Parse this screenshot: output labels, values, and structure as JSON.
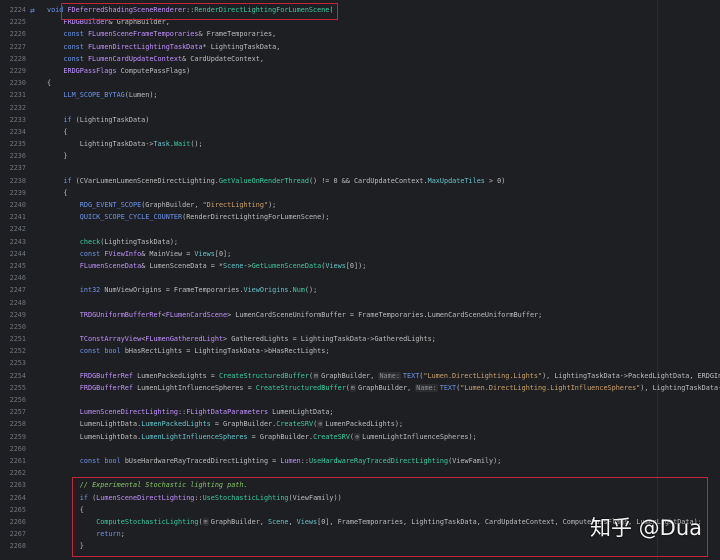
{
  "editor": {
    "watermark": "知乎 @Dua",
    "gutter_icon": "override-arrows-icon",
    "colors": {
      "highlight_box": "#c0283a",
      "background": "#1e1f22"
    },
    "lines": [
      {
        "n": "2224",
        "i": 0,
        "tok": [
          [
            "k",
            "void "
          ],
          [
            "t",
            "FDeferredShadingSceneRenderer"
          ],
          [
            "p",
            "::"
          ],
          [
            "m",
            "RenderDirectLightingForLumenScene"
          ],
          [
            "p",
            "("
          ]
        ]
      },
      {
        "n": "2225",
        "i": 1,
        "tok": [
          [
            "t",
            "FRDGBuilder"
          ],
          [
            "p",
            "& GraphBuilder,"
          ]
        ]
      },
      {
        "n": "2226",
        "i": 1,
        "tok": [
          [
            "k",
            "const "
          ],
          [
            "t",
            "FLumenSceneFrameTemporaries"
          ],
          [
            "p",
            "& FrameTemporaries,"
          ]
        ]
      },
      {
        "n": "2227",
        "i": 1,
        "tok": [
          [
            "k",
            "const "
          ],
          [
            "t",
            "FLumenDirectLightingTaskData"
          ],
          [
            "p",
            "* LightingTaskData,"
          ]
        ]
      },
      {
        "n": "2228",
        "i": 1,
        "tok": [
          [
            "k",
            "const "
          ],
          [
            "t",
            "FLumenCardUpdateContext"
          ],
          [
            "p",
            "& CardUpdateContext,"
          ]
        ]
      },
      {
        "n": "2229",
        "i": 1,
        "tok": [
          [
            "t",
            "ERDGPassFlags"
          ],
          [
            "p",
            " ComputePassFlags)"
          ]
        ]
      },
      {
        "n": "2230",
        "i": 0,
        "tok": [
          [
            "p",
            "{"
          ]
        ]
      },
      {
        "n": "2231",
        "i": 1,
        "tok": [
          [
            "mac",
            "LLM_SCOPE_BYTAG"
          ],
          [
            "p",
            "(Lumen);"
          ]
        ]
      },
      {
        "n": "2232",
        "i": 0,
        "tok": []
      },
      {
        "n": "2233",
        "i": 1,
        "tok": [
          [
            "k",
            "if "
          ],
          [
            "p",
            "(LightingTaskData)"
          ]
        ]
      },
      {
        "n": "2234",
        "i": 1,
        "tok": [
          [
            "p",
            "{"
          ]
        ]
      },
      {
        "n": "2235",
        "i": 2,
        "tok": [
          [
            "p",
            "LightingTaskData->"
          ],
          [
            "f",
            "Task"
          ],
          [
            "p",
            "."
          ],
          [
            "m",
            "Wait"
          ],
          [
            "p",
            "();"
          ]
        ]
      },
      {
        "n": "2236",
        "i": 1,
        "tok": [
          [
            "p",
            "}"
          ]
        ]
      },
      {
        "n": "2237",
        "i": 0,
        "tok": []
      },
      {
        "n": "2238",
        "i": 1,
        "tok": [
          [
            "k",
            "if "
          ],
          [
            "p",
            "(CVarLumenLumenSceneDirectLighting."
          ],
          [
            "m",
            "GetValueOnRenderThread"
          ],
          [
            "p",
            "() != 0 && CardUpdateContext."
          ],
          [
            "f",
            "MaxUpdateTiles"
          ],
          [
            "p",
            " > 0)"
          ]
        ]
      },
      {
        "n": "2239",
        "i": 1,
        "tok": [
          [
            "p",
            "{"
          ]
        ]
      },
      {
        "n": "2240",
        "i": 2,
        "tok": [
          [
            "mac",
            "RDG_EVENT_SCOPE"
          ],
          [
            "p",
            "(GraphBuilder, "
          ],
          [
            "s",
            "\"DirectLighting\""
          ],
          [
            "p",
            ");"
          ]
        ]
      },
      {
        "n": "2241",
        "i": 2,
        "tok": [
          [
            "mac",
            "QUICK_SCOPE_CYCLE_COUNTER"
          ],
          [
            "p",
            "(RenderDirectLightingForLumenScene);"
          ]
        ]
      },
      {
        "n": "2242",
        "i": 0,
        "tok": []
      },
      {
        "n": "2243",
        "i": 2,
        "tok": [
          [
            "m",
            "check"
          ],
          [
            "p",
            "(LightingTaskData);"
          ]
        ]
      },
      {
        "n": "2244",
        "i": 2,
        "tok": [
          [
            "k",
            "const "
          ],
          [
            "t",
            "FViewInfo"
          ],
          [
            "p",
            "& MainView = "
          ],
          [
            "f",
            "Views"
          ],
          [
            "p",
            "[0];"
          ]
        ]
      },
      {
        "n": "2245",
        "i": 2,
        "tok": [
          [
            "t",
            "FLumenSceneData"
          ],
          [
            "p",
            "& LumenSceneData = *"
          ],
          [
            "f",
            "Scene"
          ],
          [
            "p",
            "->"
          ],
          [
            "m",
            "GetLumenSceneData"
          ],
          [
            "p",
            "("
          ],
          [
            "f",
            "Views"
          ],
          [
            "p",
            "[0]);"
          ]
        ]
      },
      {
        "n": "2246",
        "i": 0,
        "tok": []
      },
      {
        "n": "2247",
        "i": 2,
        "tok": [
          [
            "k",
            "int32 "
          ],
          [
            "p",
            "NumViewOrigins = FrameTemporaries."
          ],
          [
            "f",
            "ViewOrigins"
          ],
          [
            "p",
            "."
          ],
          [
            "m",
            "Num"
          ],
          [
            "p",
            "();"
          ]
        ]
      },
      {
        "n": "2248",
        "i": 0,
        "tok": []
      },
      {
        "n": "2249",
        "i": 2,
        "tok": [
          [
            "t",
            "TRDGUniformBufferRef"
          ],
          [
            "p",
            "<"
          ],
          [
            "t",
            "FLumenCardScene"
          ],
          [
            "p",
            "> LumenCardSceneUniformBuffer = FrameTemporaries.LumenCardSceneUniformBuffer;"
          ]
        ]
      },
      {
        "n": "2250",
        "i": 0,
        "tok": []
      },
      {
        "n": "2251",
        "i": 2,
        "tok": [
          [
            "t",
            "TConstArrayView"
          ],
          [
            "p",
            "<"
          ],
          [
            "t",
            "FLumenGatheredLight"
          ],
          [
            "p",
            "> GatheredLights = LightingTaskData->GatheredLights;"
          ]
        ]
      },
      {
        "n": "2252",
        "i": 2,
        "tok": [
          [
            "k",
            "const bool "
          ],
          [
            "p",
            "bHasRectLights = LightingTaskData->bHasRectLights;"
          ]
        ]
      },
      {
        "n": "2253",
        "i": 0,
        "tok": []
      },
      {
        "n": "2254",
        "i": 2,
        "tok": [
          [
            "t",
            "FRDGBufferRef"
          ],
          [
            "p",
            " LumenPackedLights = "
          ],
          [
            "m",
            "CreateStructuredBuffer"
          ],
          [
            "p",
            "("
          ],
          [
            "h",
            "⊞"
          ],
          [
            "p",
            "GraphBuilder, "
          ],
          [
            "h",
            "Name:"
          ],
          [
            "mac",
            "TEXT"
          ],
          [
            "p",
            "("
          ],
          [
            "s",
            "\"Lumen.DirectLighting.Lights\""
          ],
          [
            "p",
            "), LightingTaskData->PackedLightData, ERDGIn"
          ]
        ]
      },
      {
        "n": "2255",
        "i": 2,
        "tok": [
          [
            "t",
            "FRDGBufferRef"
          ],
          [
            "p",
            " LumenLightInfluenceSpheres = "
          ],
          [
            "m",
            "CreateStructuredBuffer"
          ],
          [
            "p",
            "("
          ],
          [
            "h",
            "⊞"
          ],
          [
            "p",
            "GraphBuilder, "
          ],
          [
            "h",
            "Name:"
          ],
          [
            "mac",
            "TEXT"
          ],
          [
            "p",
            "("
          ],
          [
            "s",
            "\"Lumen.DirectLighting.LightInfluenceSpheres\""
          ],
          [
            "p",
            "), LightingTaskData-"
          ]
        ]
      },
      {
        "n": "2256",
        "i": 0,
        "tok": []
      },
      {
        "n": "2257",
        "i": 2,
        "tok": [
          [
            "t",
            "LumenSceneDirectLighting"
          ],
          [
            "p",
            "::"
          ],
          [
            "t",
            "FLightDataParameters"
          ],
          [
            "p",
            " LumenLightData;"
          ]
        ]
      },
      {
        "n": "2258",
        "i": 2,
        "tok": [
          [
            "p",
            "LumenLightData."
          ],
          [
            "f",
            "LumenPackedLights"
          ],
          [
            "p",
            " = GraphBuilder."
          ],
          [
            "m",
            "CreateSRV"
          ],
          [
            "p",
            "("
          ],
          [
            "h",
            "⊕"
          ],
          [
            "p",
            "LumenPackedLights);"
          ]
        ]
      },
      {
        "n": "2259",
        "i": 2,
        "tok": [
          [
            "p",
            "LumenLightData."
          ],
          [
            "f",
            "LumenLightInfluenceSpheres"
          ],
          [
            "p",
            " = GraphBuilder."
          ],
          [
            "m",
            "CreateSRV"
          ],
          [
            "p",
            "("
          ],
          [
            "h",
            "⊕"
          ],
          [
            "p",
            "LumenLightInfluenceSpheres);"
          ]
        ]
      },
      {
        "n": "2260",
        "i": 0,
        "tok": []
      },
      {
        "n": "2261",
        "i": 2,
        "tok": [
          [
            "k",
            "const bool "
          ],
          [
            "p",
            "bUseHardwareRayTracedDirectLighting = "
          ],
          [
            "t",
            "Lumen"
          ],
          [
            "p",
            "::"
          ],
          [
            "m",
            "UseHardwareRayTracedDirectLighting"
          ],
          [
            "p",
            "(ViewFamily);"
          ]
        ]
      },
      {
        "n": "2262",
        "i": 0,
        "tok": []
      },
      {
        "n": "2263",
        "i": 2,
        "tok": [
          [
            "c",
            "// Experimental Stochastic lighting path."
          ]
        ]
      },
      {
        "n": "2264",
        "i": 2,
        "tok": [
          [
            "k",
            "if "
          ],
          [
            "p",
            "("
          ],
          [
            "t",
            "LumenSceneDirectLighting"
          ],
          [
            "p",
            "::"
          ],
          [
            "m",
            "UseStochasticLighting"
          ],
          [
            "p",
            "(ViewFamily))"
          ]
        ]
      },
      {
        "n": "2265",
        "i": 2,
        "tok": [
          [
            "p",
            "{"
          ]
        ]
      },
      {
        "n": "2266",
        "i": 3,
        "tok": [
          [
            "m",
            "ComputeStochasticLighting"
          ],
          [
            "p",
            "("
          ],
          [
            "h",
            "⊞"
          ],
          [
            "p",
            "GraphBuilder, "
          ],
          [
            "f",
            "Scene"
          ],
          [
            "p",
            ", "
          ],
          [
            "f",
            "Views"
          ],
          [
            "p",
            "[0], FrameTemporaries, LightingTaskData, CardUpdateContext, ComputePassFlags, LumenLightData);"
          ]
        ]
      },
      {
        "n": "2267",
        "i": 3,
        "tok": [
          [
            "k",
            "return"
          ],
          [
            "p",
            ";"
          ]
        ]
      },
      {
        "n": "2268",
        "i": 2,
        "tok": [
          [
            "p",
            "}"
          ]
        ]
      }
    ]
  }
}
